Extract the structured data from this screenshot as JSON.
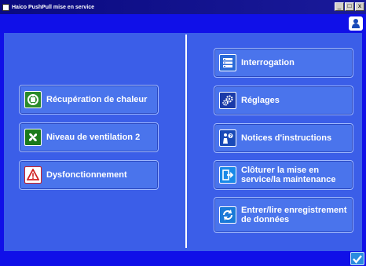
{
  "window": {
    "title": "Haico PushPull mise en service",
    "controls": [
      "_",
      "□",
      "x"
    ]
  },
  "left_menu": [
    {
      "label": "Récupération de chaleur",
      "icon": "heat-recovery-icon",
      "icon_bg": "#2a8a2a"
    },
    {
      "label": "Niveau de ventilation 2",
      "icon": "fan-icon",
      "icon_bg": "#1a7a1a"
    },
    {
      "label": "Dysfonctionnement",
      "icon": "warning-icon",
      "icon_bg": "#ffffff"
    }
  ],
  "right_menu": [
    {
      "label": "Interrogation",
      "icon": "list-icon",
      "icon_bg": "#2a6ad8"
    },
    {
      "label": "Réglages",
      "icon": "gears-icon",
      "icon_bg": "#1a3aa8"
    },
    {
      "label": "Notices d'instructions",
      "icon": "help-person-icon",
      "icon_bg": "#1a4ab8"
    },
    {
      "label": "Clôturer la mise en service/la maintenance",
      "icon": "exit-door-icon",
      "icon_bg": "#1a8ae8"
    },
    {
      "label": "Entrer/lire enregistrement de données",
      "icon": "refresh-icon",
      "icon_bg": "#1a7ad8"
    }
  ],
  "colors": {
    "background": "#1010e8",
    "panel": "#3b5ee8",
    "button": "#4a74ec"
  }
}
